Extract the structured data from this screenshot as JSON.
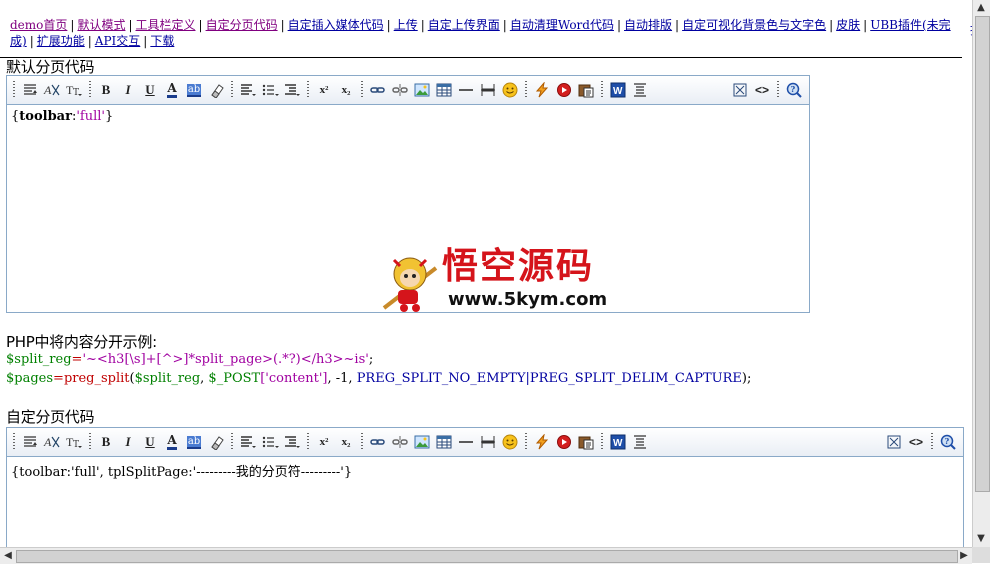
{
  "nav": {
    "items": [
      {
        "label": "demo首页",
        "visited": true
      },
      {
        "label": "默认模式",
        "visited": true
      },
      {
        "label": "工具栏定义",
        "visited": true
      },
      {
        "label": "自定分页代码",
        "visited": true
      },
      {
        "label": "自定插入媒体代码",
        "visited": false
      },
      {
        "label": "上传",
        "visited": false
      },
      {
        "label": "自定上传界面",
        "visited": false
      },
      {
        "label": "自动清理Word代码",
        "visited": false
      },
      {
        "label": "自动排版",
        "visited": false
      },
      {
        "label": "自定可视化背景色与文字色",
        "visited": false
      },
      {
        "label": "皮肤",
        "visited": false
      },
      {
        "label": "UBB插件(未完成)",
        "visited": false
      },
      {
        "label": "扩展功能",
        "visited": false
      },
      {
        "label": "API交互",
        "visited": false
      },
      {
        "label": "下载",
        "visited": false
      }
    ],
    "separator": "|",
    "clipped_right": "指"
  },
  "section1": {
    "title": "默认分页代码",
    "editor_content": {
      "open": "{",
      "key": "toolbar",
      "colon": ":",
      "value": "'full'",
      "close": "}"
    }
  },
  "php": {
    "heading": "PHP中将内容分开示例:",
    "line1": {
      "var": "$split_reg",
      "eq": "=",
      "str": "'~<h3[\\s]+[^>]*split_page>(.*?)</h3>~is'",
      "end": ";"
    },
    "line2": {
      "var": "$pages",
      "eq": "=",
      "func": "preg_split",
      "open": "(",
      "arg1": "$split_reg",
      "comma1": ", ",
      "arg2": "$_POST",
      "key": "['content']",
      "rest": ", -1, ",
      "flags": "PREG_SPLIT_NO_EMPTY|PREG_SPLIT_DELIM_CAPTURE",
      "end": ");"
    }
  },
  "section2": {
    "title": "自定分页代码",
    "editor_content": "{toolbar:'full', tplSplitPage:'---------我的分页符---------'}"
  },
  "watermark": {
    "title": "悟空源码",
    "url": "www.5kym.com"
  },
  "toolbar": {
    "buttons": [
      "paragraph-icon",
      "font-icon",
      "font-size-icon",
      "bold-icon",
      "italic-icon",
      "underline-icon",
      "font-color-icon",
      "background-color-icon",
      "remove-format-icon",
      "align-icon",
      "list-icon",
      "outdent-icon",
      "superscript-icon",
      "subscript-icon",
      "link-icon",
      "unlink-icon",
      "image-icon",
      "table-icon",
      "horizontal-rule-icon",
      "page-break-icon",
      "emoticon-icon",
      "flash-icon",
      "media-icon",
      "paste-text-icon",
      "word-icon",
      "clean-icon",
      "fullscreen-icon",
      "source-icon",
      "about-icon"
    ],
    "labels": {
      "bold": "B",
      "italic": "I",
      "underline": "U",
      "color": "A",
      "bg": "ab",
      "superscript": "x²",
      "subscript": "x₂",
      "source": "<>"
    }
  }
}
